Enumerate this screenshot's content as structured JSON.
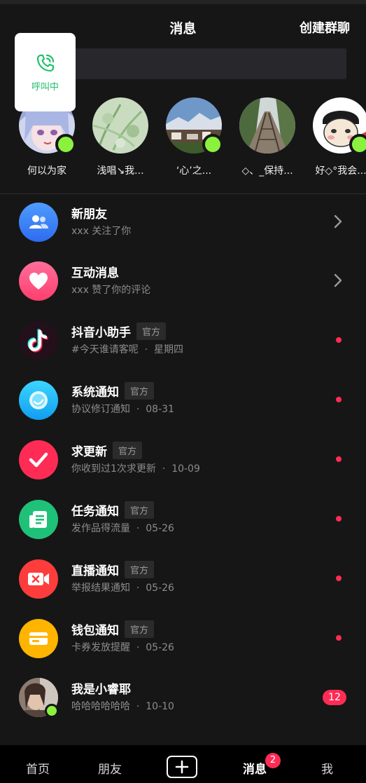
{
  "header": {
    "title": "消息",
    "create_group": "创建群聊"
  },
  "call_card": {
    "status": "呼叫中",
    "icon": "phone-ringing-icon",
    "color": "#22c06e"
  },
  "stories": [
    {
      "name": "何以为家",
      "online": true
    },
    {
      "name": "浅唱↘我...",
      "online": false
    },
    {
      "name": "‘心’之...",
      "online": true
    },
    {
      "name": "◇、_保持...",
      "online": false
    },
    {
      "name": "好◇°我会...",
      "online": true
    }
  ],
  "messages": [
    {
      "title": "新朋友",
      "subtitle": "xxx 关注了你",
      "icon": "people-icon",
      "trailing": "chevron"
    },
    {
      "title": "互动消息",
      "subtitle": "xxx 赞了你的评论",
      "icon": "heart-icon",
      "trailing": "chevron"
    },
    {
      "title": "抖音小助手",
      "badge": "官方",
      "subtitle": "#今天谁请客呢",
      "time": "星期四",
      "icon": "tiktok-icon",
      "trailing": "dot"
    },
    {
      "title": "系统通知",
      "badge": "官方",
      "subtitle": "协议修订通知",
      "time": "08-31",
      "icon": "system-notice-icon",
      "trailing": "dot"
    },
    {
      "title": "求更新",
      "badge": "官方",
      "subtitle": "你收到过1次求更新",
      "time": "10-09",
      "icon": "check-icon",
      "trailing": "dot"
    },
    {
      "title": "任务通知",
      "badge": "官方",
      "subtitle": "发作品得流量",
      "time": "05-26",
      "icon": "task-icon",
      "trailing": "dot"
    },
    {
      "title": "直播通知",
      "badge": "官方",
      "subtitle": "举报结果通知",
      "time": "05-26",
      "icon": "live-camera-icon",
      "trailing": "dot"
    },
    {
      "title": "钱包通知",
      "badge": "官方",
      "subtitle": "卡券发放提醒",
      "time": "05-26",
      "icon": "wallet-icon",
      "trailing": "dot"
    },
    {
      "title": "我是小睿耶",
      "subtitle": "哈哈哈哈哈哈",
      "time": "10-10",
      "icon": "user-avatar",
      "trailing": "count",
      "count": "12"
    }
  ],
  "separator": "·",
  "bottom_nav": {
    "home": "首页",
    "friends": "朋友",
    "messages": "消息",
    "me": "我",
    "messages_badge": "2"
  },
  "colors": {
    "accent": "#fe2c55",
    "online": "#8af23e",
    "background": "#161616"
  }
}
